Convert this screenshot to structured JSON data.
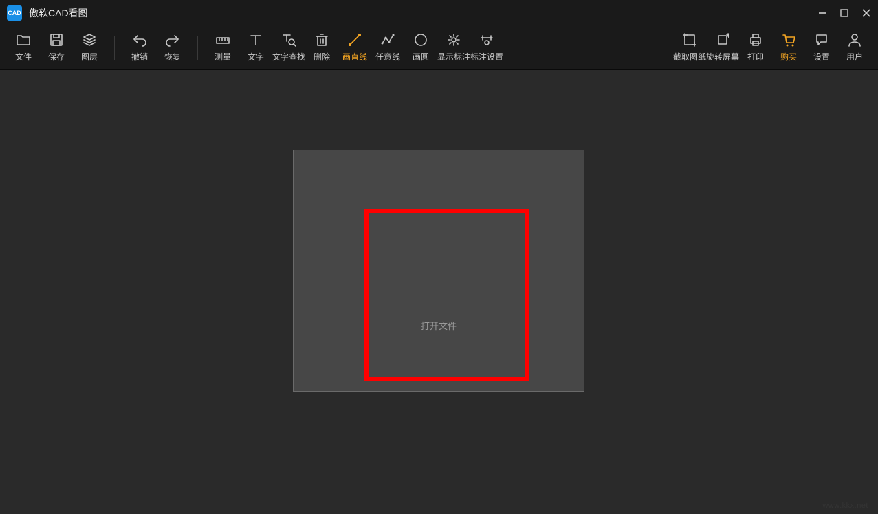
{
  "titlebar": {
    "app_name": "傲软CAD看图",
    "logo_text": "CAD"
  },
  "toolbar": {
    "groups": [
      {
        "items": [
          {
            "name": "file-button",
            "icon": "folder-icon",
            "label": "文件"
          },
          {
            "name": "save-button",
            "icon": "save-icon",
            "label": "保存"
          },
          {
            "name": "layers-button",
            "icon": "layers-icon",
            "label": "图层"
          }
        ]
      },
      {
        "items": [
          {
            "name": "undo-button",
            "icon": "undo-icon",
            "label": "撤销"
          },
          {
            "name": "redo-button",
            "icon": "redo-icon",
            "label": "恢复"
          }
        ]
      },
      {
        "items": [
          {
            "name": "measure-button",
            "icon": "ruler-icon",
            "label": "测量"
          },
          {
            "name": "text-button",
            "icon": "text-icon",
            "label": "文字"
          },
          {
            "name": "text-find-button",
            "icon": "find-text-icon",
            "label": "文字查找"
          },
          {
            "name": "delete-button",
            "icon": "trash-icon",
            "label": "删除"
          },
          {
            "name": "draw-line-button",
            "icon": "line-icon",
            "label": "画直线",
            "orange": true
          },
          {
            "name": "draw-polyline-button",
            "icon": "polyline-icon",
            "label": "任意线"
          },
          {
            "name": "draw-circle-button",
            "icon": "circle-icon",
            "label": "画圆"
          },
          {
            "name": "show-annotations-button",
            "icon": "annotation-show-icon",
            "label": "显示标注"
          },
          {
            "name": "annotation-settings-button",
            "icon": "annotation-settings-icon",
            "label": "标注设置"
          }
        ]
      },
      {
        "spacer": true
      },
      {
        "items": [
          {
            "name": "capture-drawing-button",
            "icon": "crop-icon",
            "label": "截取图纸"
          },
          {
            "name": "rotate-screen-button",
            "icon": "rotate-icon",
            "label": "旋转屏幕"
          },
          {
            "name": "print-button",
            "icon": "printer-icon",
            "label": "打印"
          },
          {
            "name": "buy-button",
            "icon": "cart-icon",
            "label": "购买",
            "orange": true
          },
          {
            "name": "settings-button",
            "icon": "chat-icon",
            "label": "设置"
          },
          {
            "name": "user-button",
            "icon": "user-icon",
            "label": "用户"
          }
        ]
      }
    ]
  },
  "main": {
    "open_file_label": "打开文件"
  },
  "watermark": "www.kkx.net"
}
